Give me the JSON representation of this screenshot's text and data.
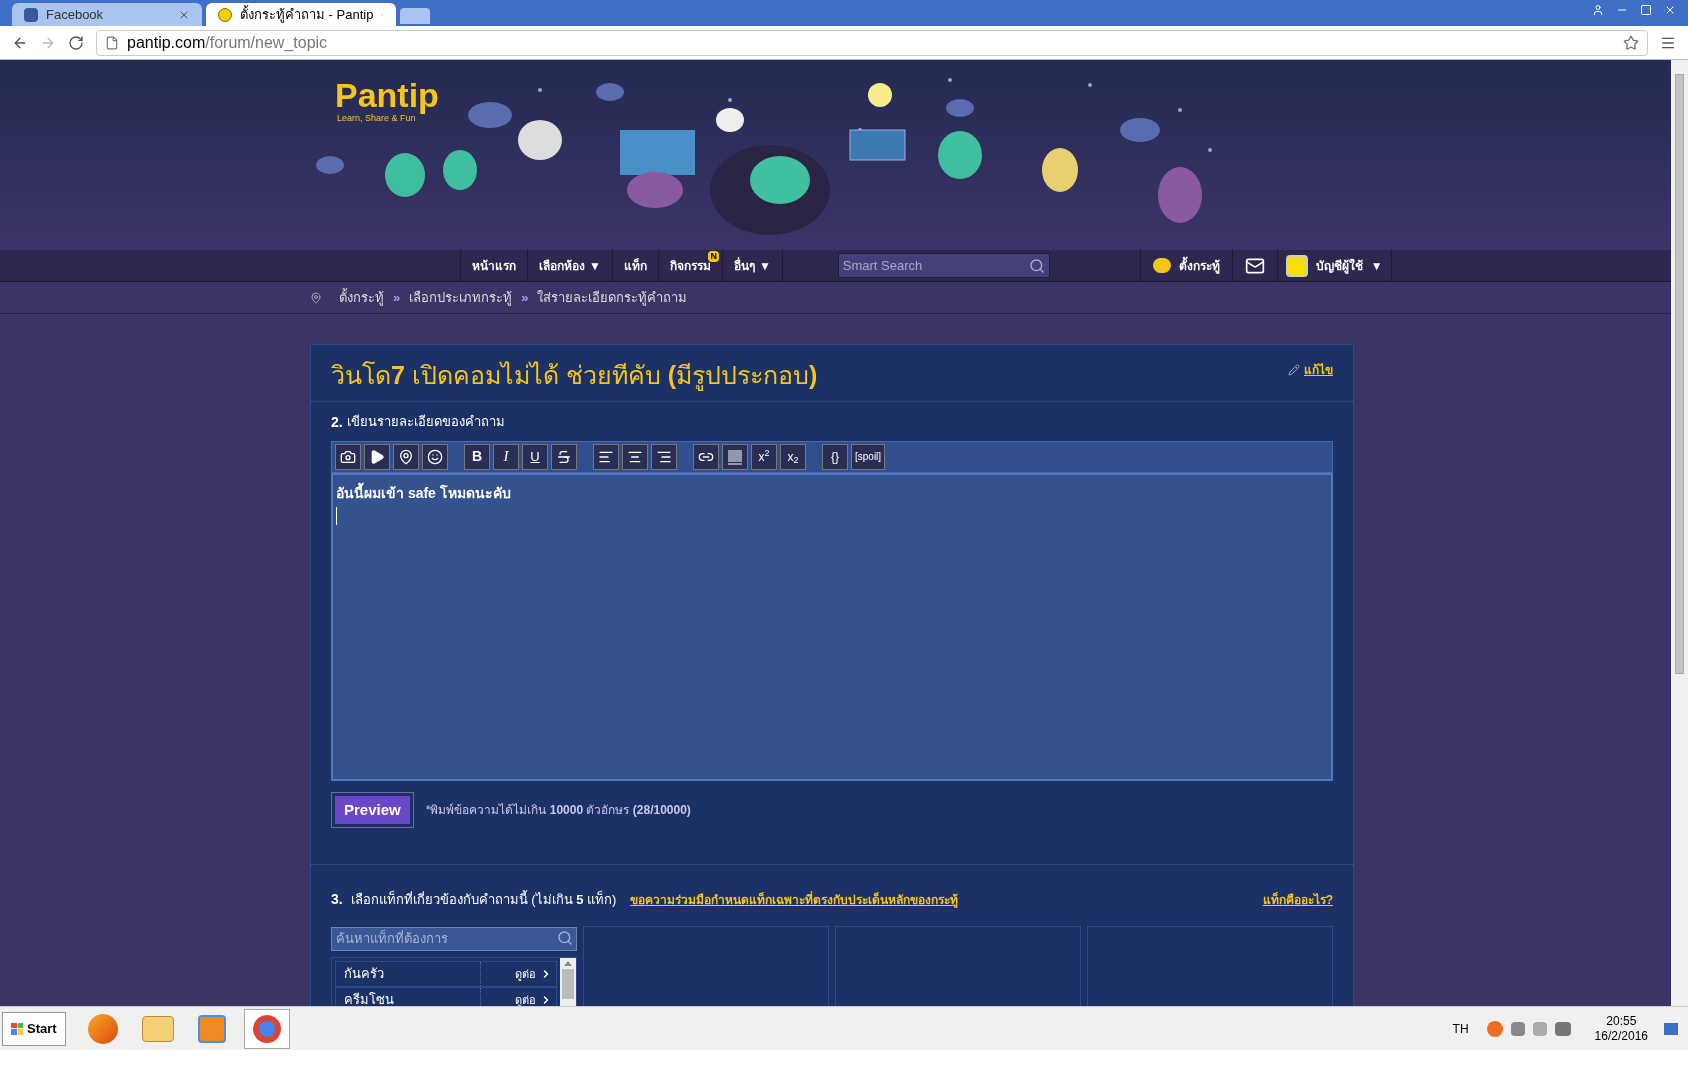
{
  "browser": {
    "tabs": [
      {
        "title": "Facebook",
        "selected": false
      },
      {
        "title": "ตั้งกระทู้คำถาม - Pantip",
        "selected": true
      }
    ],
    "url_host": "pantip.com",
    "url_path": "/forum/new_topic"
  },
  "site": {
    "logo": "Pantip",
    "tagline": "Learn, Share & Fun"
  },
  "nav": {
    "items": [
      {
        "label": "หน้าแรก"
      },
      {
        "label": "เลือกห้อง",
        "caret": "▼"
      },
      {
        "label": "แท็ก"
      },
      {
        "label": "กิจกรรม",
        "badge": "N"
      },
      {
        "label": "อื่นๆ",
        "caret": "▼"
      }
    ],
    "search_placeholder": "Smart Search",
    "post_label": "ตั้งกระทู้",
    "account_label": "บัญชีผู้ใช้",
    "account_caret": "▼"
  },
  "breadcrumb": {
    "separator": "»",
    "items": [
      "ตั้งกระทู้",
      "เลือกประเภทกระทู้",
      "ใส่รายละเอียดกระทู้คำถาม"
    ]
  },
  "form": {
    "title": "วินโด**7** เปิดคอมไม่ได้ ช่วยทีคับ **(**มีรูปประกอบ**)**",
    "edit_link": "แก้ไข",
    "step2": {
      "number": "2.",
      "label": "เขียนรายละเอียดของคำถาม"
    },
    "toolbar": [
      [
        {
          "kind": "camera"
        },
        {
          "kind": "video"
        },
        {
          "kind": "pin"
        },
        {
          "kind": "emoji"
        }
      ],
      [
        {
          "kind": "text",
          "label": "B"
        },
        {
          "kind": "text",
          "label": "I"
        },
        {
          "kind": "text",
          "label": "U"
        },
        {
          "kind": "strikethrough"
        }
      ],
      [
        {
          "kind": "align-left"
        },
        {
          "kind": "align-center"
        },
        {
          "kind": "align-right"
        }
      ],
      [
        {
          "kind": "link"
        },
        {
          "kind": "rule"
        },
        {
          "kind": "text",
          "label": "x$^{2}$"
        },
        {
          "kind": "text",
          "label": "x$_{2}$"
        }
      ],
      [
        {
          "kind": "text",
          "label": "{}"
        },
        {
          "kind": "text",
          "label": "[spoil]"
        }
      ]
    ],
    "body": "อันนี้ผมเข้า safe โหมดนะคับ",
    "preview_button": "Preview",
    "limit_note": "*พิมพ์ข้อความได้ไม่เกิน **10000** ตัวอักษร **(28/10000)**",
    "step3": {
      "number": "3.",
      "label": "เลือกแท็กที่เกี่ยวข้องกับคำถามนี้ (ไม่เกิน **5** แท็ก)",
      "request_link": "ขอความร่วมมือกำหนดแท็กเฉพาะที่ตรงกับประเด็นหลักของกระทู้",
      "help_link": "แท็กคืออะไร**?**"
    },
    "tag_search_placeholder": "ค้นหาแท็กที่ต้องการ",
    "tags": [
      {
        "name": "กันครัว",
        "more": "ดูต่อ"
      },
      {
        "name": "ครีมโซน",
        "more": "ดูต่อ"
      }
    ]
  },
  "taskbar": {
    "start": "Start",
    "language": "TH",
    "time": "20:55",
    "date": "16/2/2016"
  }
}
